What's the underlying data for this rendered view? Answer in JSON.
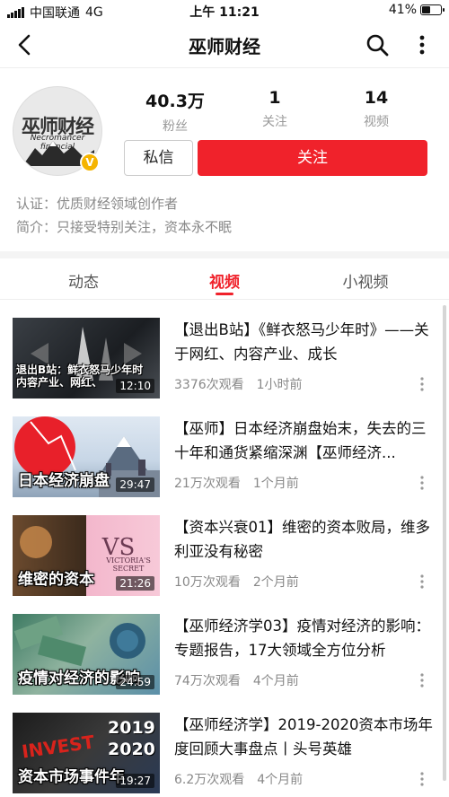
{
  "status_bar": {
    "carrier": "中国联通",
    "network": "4G",
    "time": "上午 11:21",
    "battery": "41%",
    "battery_level": 0.41
  },
  "nav": {
    "title": "巫师财经",
    "back_icon": "back-arrow-icon",
    "search_icon": "search-icon",
    "more_icon": "more-vertical-icon"
  },
  "profile": {
    "avatar_text": "巫师财经",
    "avatar_subtext": "Necromancer financial",
    "verified_badge": "V",
    "stats": [
      {
        "value": "40.3万",
        "label": "粉丝"
      },
      {
        "value": "1",
        "label": "关注"
      },
      {
        "value": "14",
        "label": "视频"
      }
    ],
    "message_button": "私信",
    "follow_button": "关注",
    "certification": "认证：优质财经领域创作者",
    "bio": "简介：只接受特别关注，资本永不眠"
  },
  "tabs": [
    {
      "label": "动态",
      "active": false
    },
    {
      "label": "视频",
      "active": true
    },
    {
      "label": "小视频",
      "active": false
    }
  ],
  "videos": [
    {
      "title": "【退出B站】《鲜衣怒马少年时》——关于网红、内容产业、成长",
      "views": "3376次观看",
      "time": "1小时前",
      "duration": "12:10",
      "thumb_lines": [
        "退出B站：鲜衣怒马少年时",
        "内容产业、网红、"
      ]
    },
    {
      "title": "【巫师】日本经济崩盘始末，失去的三十年和通货紧缩深渊【巫师经济...",
      "views": "21万次观看",
      "time": "1个月前",
      "duration": "29:47",
      "thumb_lines": [
        "日本经济崩盘"
      ]
    },
    {
      "title": "【资本兴衰01】维密的资本败局，维多利亚没有秘密",
      "views": "10万次观看",
      "time": "2个月前",
      "duration": "21:26",
      "thumb_lines": [
        "维密的资本"
      ],
      "thumb_brand": "VICTORIA'S SECRET"
    },
    {
      "title": "【巫师经济学03】疫情对经济的影响：专题报告，17大领域全方位分析",
      "views": "74万次观看",
      "time": "4个月前",
      "duration": "24:59",
      "thumb_lines": [
        "疫情对经济的影响"
      ]
    },
    {
      "title": "【巫师经济学】2019-2020资本市场年度回顾大事盘点丨头号英雄",
      "views": "6.2万次观看",
      "time": "4个月前",
      "duration": "19:27",
      "thumb_lines": [
        "资本市场事件年"
      ],
      "thumb_year1": "2019",
      "thumb_year2": "2020",
      "thumb_word": "INVEST"
    }
  ],
  "colors": {
    "accent": "#f0222b",
    "muted": "#888888",
    "badge": "#f5b400"
  }
}
